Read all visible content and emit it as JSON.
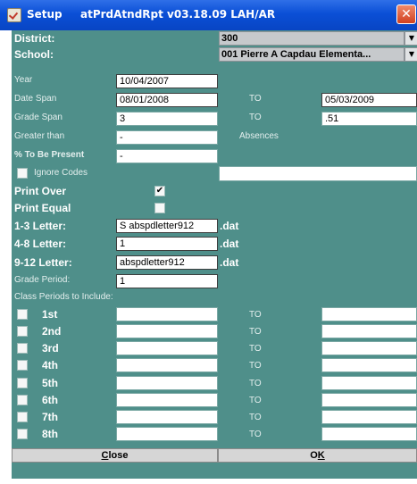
{
  "window": {
    "title_app": "Setup",
    "title_info": "atPrdAtndRpt v03.18.09 LAH/AR",
    "close_glyph": "✕"
  },
  "form": {
    "district_label": "District:",
    "district_value": "300",
    "school_label": "School:",
    "school_value": "001 Pierre A Capdau Elementa...",
    "year_label": "Year",
    "year_value": "10/04/2007",
    "date_span_label": "Date Span",
    "date_from": "08/01/2008",
    "date_to_label": "TO",
    "date_to": "05/03/2009",
    "grade_span_label": "Grade Span",
    "grade_from": "3",
    "grade_to_label": "TO",
    "grade_to": ".51",
    "greater_than_label": "Greater than",
    "greater_than_value": "-",
    "absences_label": "Absences",
    "pct_present_label": "% To Be Present",
    "pct_present_value": "-",
    "ignore_codes_label": "Ignore Codes",
    "ignore_codes_value": "",
    "print_over_label": "Print Over",
    "print_over_checked": true,
    "print_equal_label": "Print Equal",
    "print_equal_checked": false,
    "check_glyph": "✔",
    "letter_1_3_label": "1-3 Letter:",
    "letter_1_3_value": "S abspdletter912",
    "letter_4_8_label": "4-8 Letter:",
    "letter_4_8_value": "1",
    "letter_9_12_label": "9-12 Letter:",
    "letter_9_12_value": "abspdletter912",
    "dat_suffix": ".dat",
    "grade_period_label": "Grade Period:",
    "grade_period_value": "1",
    "class_periods_label": "Class Periods to Include:",
    "dropdown_arrow": "▼"
  },
  "periods": [
    {
      "label": "1st",
      "to_label": "TO",
      "from": "",
      "to": ""
    },
    {
      "label": "2nd",
      "to_label": "TO",
      "from": "",
      "to": ""
    },
    {
      "label": "3rd",
      "to_label": "TO",
      "from": "",
      "to": ""
    },
    {
      "label": "4th",
      "to_label": "TO",
      "from": "",
      "to": ""
    },
    {
      "label": "5th",
      "to_label": "TO",
      "from": "",
      "to": ""
    },
    {
      "label": "6th",
      "to_label": "TO",
      "from": "",
      "to": ""
    },
    {
      "label": "7th",
      "to_label": "TO",
      "from": "",
      "to": ""
    },
    {
      "label": "8th",
      "to_label": "TO",
      "from": "",
      "to": ""
    }
  ],
  "buttons": {
    "close_mnemonic": "C",
    "close_rest": "lose",
    "ok_first": "O",
    "ok_mnemonic": "K"
  }
}
